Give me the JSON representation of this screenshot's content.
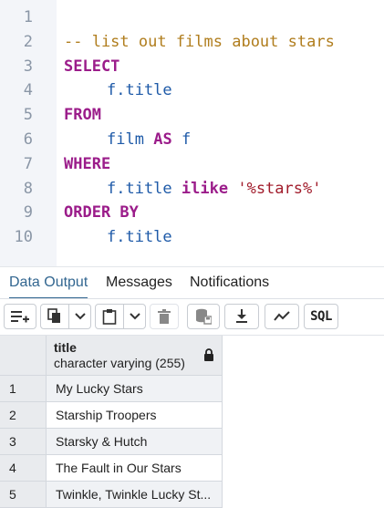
{
  "editor": {
    "line_numbers": [
      "1",
      "2",
      "3",
      "4",
      "5",
      "6",
      "7",
      "8",
      "9",
      "10"
    ],
    "lines": {
      "l2_comment": "-- list out films about stars",
      "l3_select": "SELECT",
      "l4_field": "f.title",
      "l5_from": "FROM",
      "l6_table": "film",
      "l6_as": "AS",
      "l6_alias": "f",
      "l7_where": "WHERE",
      "l8_field": "f.title",
      "l8_op": "ilike",
      "l8_str": "'%stars%'",
      "l9_order": "ORDER BY",
      "l10_field": "f.title"
    }
  },
  "tabs": [
    {
      "label": "Data Output",
      "active": true
    },
    {
      "label": "Messages",
      "active": false
    },
    {
      "label": "Notifications",
      "active": false
    }
  ],
  "toolbar": {
    "icons": [
      "add-row-icon",
      "copy-icon",
      "chevron-down-icon",
      "paste-icon",
      "chevron-down-icon",
      "delete-icon",
      "save-data-icon",
      "download-icon",
      "graph-icon"
    ],
    "sql_label": "SQL"
  },
  "grid": {
    "column": {
      "name": "title",
      "type": "character varying (255)",
      "locked_icon": "lock-icon"
    },
    "rows": [
      {
        "num": "1",
        "title": "My Lucky Stars"
      },
      {
        "num": "2",
        "title": "Starship Troopers"
      },
      {
        "num": "3",
        "title": "Starsky & Hutch"
      },
      {
        "num": "4",
        "title": "The Fault in Our Stars"
      },
      {
        "num": "5",
        "title": "Twinkle, Twinkle Lucky St..."
      }
    ]
  },
  "colors": {
    "keyword": "#9b1c8a",
    "comment": "#b07d1d",
    "string": "#a11c2b",
    "identifier": "#1e5aa8",
    "active_tab": "#326690"
  }
}
